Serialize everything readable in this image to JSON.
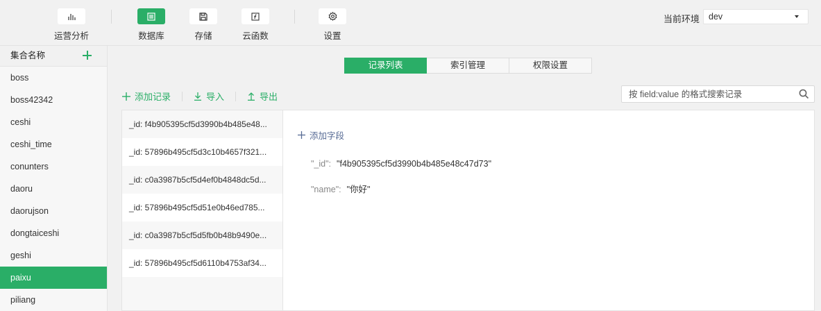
{
  "toolbar": {
    "tools": [
      {
        "label": "运营分析",
        "icon": "bar-chart-icon"
      },
      {
        "label": "数据库",
        "icon": "database-icon"
      },
      {
        "label": "存储",
        "icon": "save-icon"
      },
      {
        "label": "云函数",
        "icon": "function-icon"
      },
      {
        "label": "设置",
        "icon": "gear-icon"
      }
    ],
    "env_label": "当前环境",
    "env_value": "dev"
  },
  "sidebar": {
    "header": "集合名称",
    "items": [
      "boss",
      "boss42342",
      "ceshi",
      "ceshi_time",
      "conunters",
      "daoru",
      "daorujson",
      "dongtaiceshi",
      "geshi",
      "paixu",
      "piliang"
    ],
    "active": "paixu"
  },
  "tabs": [
    "记录列表",
    "索引管理",
    "权限设置"
  ],
  "actions": {
    "add": "添加记录",
    "import": "导入",
    "export": "导出"
  },
  "search": {
    "placeholder": "按 field:value 的格式搜索记录"
  },
  "records": [
    "_id: f4b905395cf5d3990b4b485e48...",
    "_id: 57896b495cf5d3c10b4657f321...",
    "_id: c0a3987b5cf5d4ef0b4848dc5d...",
    "_id: 57896b495cf5d51e0b46ed785...",
    "_id: c0a3987b5cf5d5fb0b48b9490e...",
    "_id: 57896b495cf5d6110b4753af34..."
  ],
  "detail": {
    "add_field": "添加字段",
    "fields": [
      {
        "key": "\"_id\":",
        "value": "\"f4b905395cf5d3990b4b485e48c47d73\""
      },
      {
        "key": "\"name\":",
        "value": "\"你好\""
      }
    ]
  },
  "colors": {
    "accent": "#2aae67",
    "link": "#576b95"
  }
}
